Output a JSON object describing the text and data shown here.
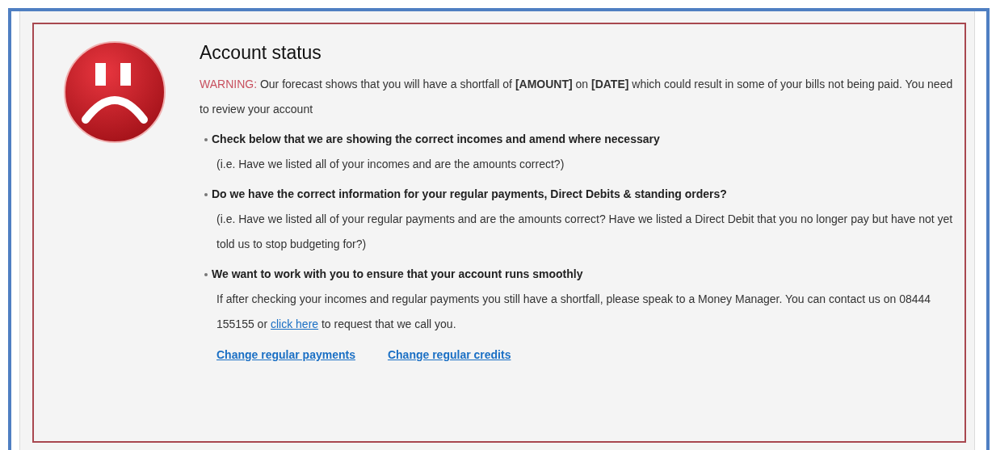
{
  "title": "Account status",
  "warning": {
    "label": "WARNING:",
    "text": "Our forecast shows that you will have a shortfall of **[AMOUNT]** on **[DATE]** which could result in some of your bills not being paid. You need to review your account"
  },
  "items": [
    {
      "heading": "Check below that we are showing the correct incomes and amend where necessary",
      "detail": {
        "before": "(i.e. Have we listed all of your incomes and are the amounts correct?)"
      }
    },
    {
      "heading": "Do we have the correct information for your regular payments, Direct Debits & standing orders?",
      "detail": {
        "before": "(i.e. Have we listed all of your regular payments and are the amounts correct? Have we listed a Direct Debit that you no longer pay but have not yet told us to stop budgeting for?)"
      }
    },
    {
      "heading": "We want to work with you to ensure that your account runs smoothly",
      "detail": {
        "before": "If after checking your incomes and regular payments you still have a shortfall, please speak to a Money Manager. You can contact us on 08444 155155 or",
        "link": "click here",
        "after": "to request that we call you."
      }
    }
  ],
  "links": [
    "Change regular payments",
    "Change regular credits"
  ]
}
